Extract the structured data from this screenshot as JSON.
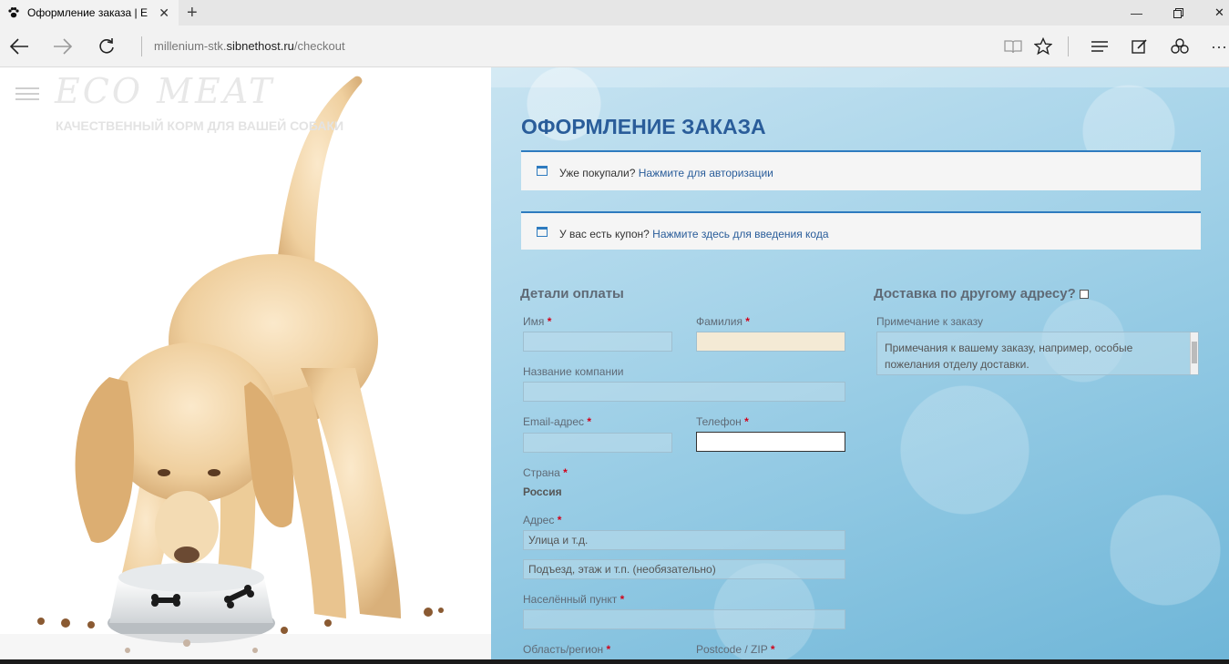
{
  "browser": {
    "tab_title": "Оформление заказа | E",
    "tab_favicon": "paw-icon",
    "url_prefix": "millenium-stk.",
    "url_host": "sibnethost.ru",
    "url_path": "/checkout"
  },
  "header": {
    "logo": "ECO MEAT",
    "tagline": "КАЧЕСТВЕННЫЙ КОРМ ДЛЯ ВАШЕЙ СОБАКИ"
  },
  "checkout": {
    "title": "ОФОРМЛЕНИЕ ЗАКАЗА",
    "login_notice": {
      "text": "Уже покупали? ",
      "link": "Нажмите для авторизации"
    },
    "coupon_notice": {
      "text": "У вас есть купон? ",
      "link": "Нажмите здесь для введения кода"
    },
    "billing": {
      "heading": "Детали оплаты",
      "first_name": "Имя",
      "last_name": "Фамилия",
      "company": "Название компании",
      "email": "Email-адрес",
      "phone": "Телефон",
      "country": "Страна",
      "country_value": "Россия",
      "address": "Адрес",
      "address1_placeholder": "Улица и т.д.",
      "address2_placeholder": "Подъезд, этаж и т.п. (необязательно)",
      "city": "Населённый пункт",
      "region": "Область/регион",
      "postcode": "Postcode / ZIP",
      "required_mark": "*"
    },
    "shipping": {
      "heading": "Доставка по другому адресу?",
      "notes_label": "Примечание к заказу",
      "notes_placeholder": "Примечания к вашему заказу, например, особые пожелания отделу доставки."
    }
  },
  "colors": {
    "accent": "#2a5d9a",
    "notice_border": "#2e7bbf",
    "required": "#d0021b"
  }
}
